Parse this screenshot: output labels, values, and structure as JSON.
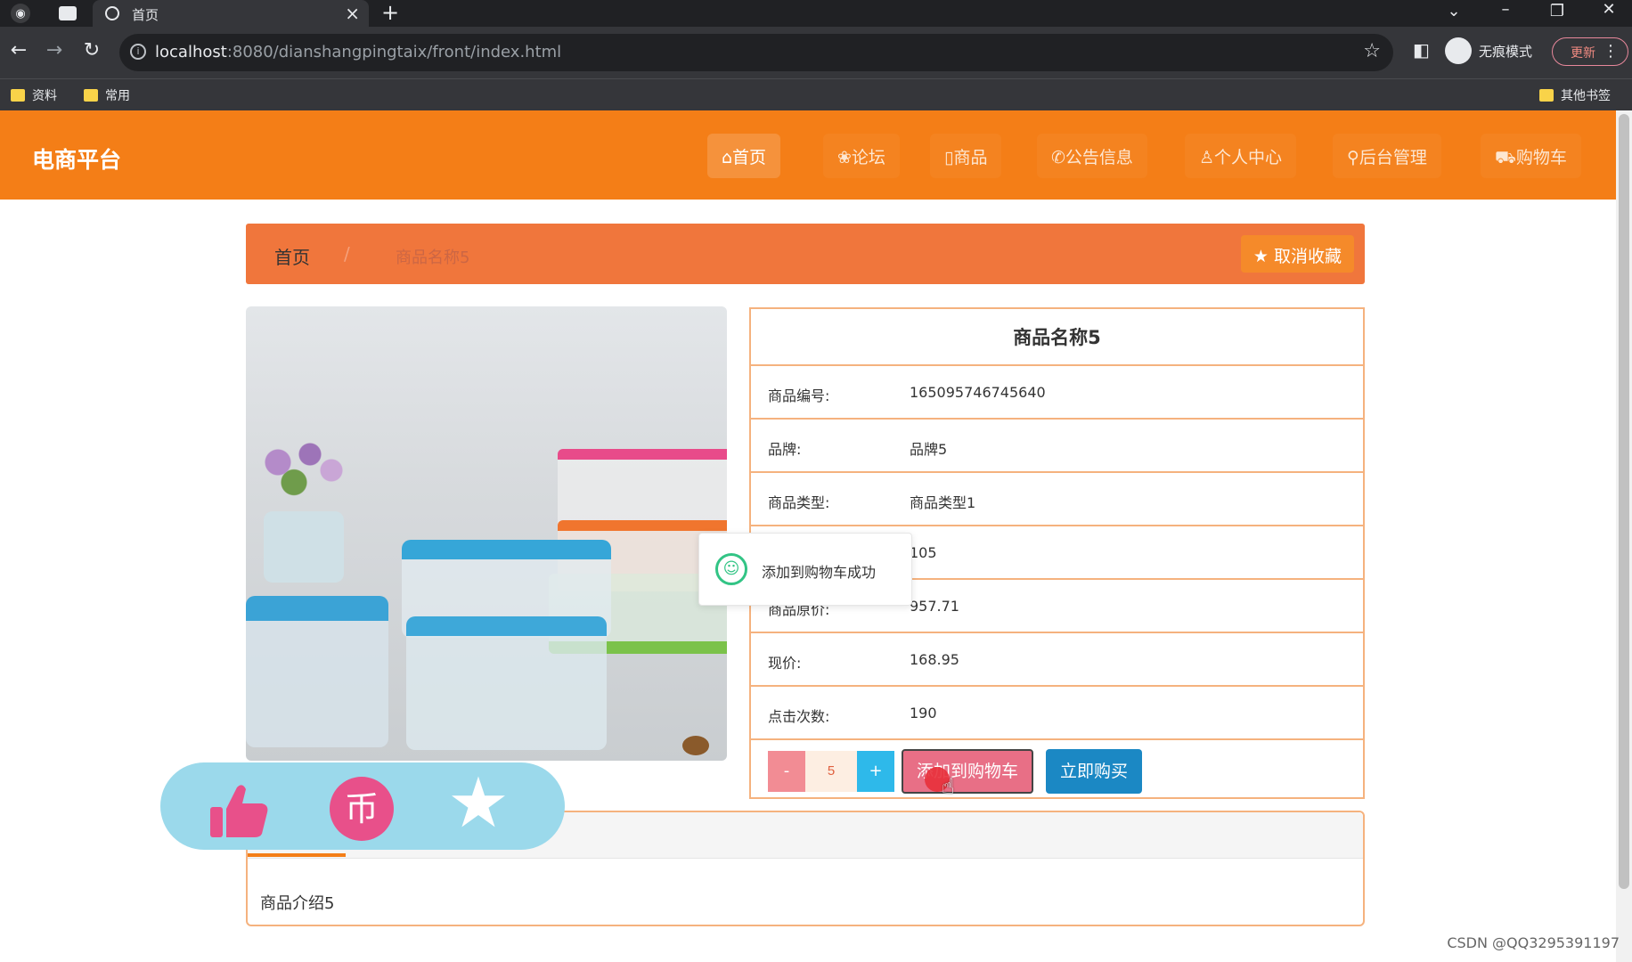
{
  "browser": {
    "tab_title": "首页",
    "url_host": "localhost",
    "url_rest": ":8080/dianshangpingtaix/front/index.html",
    "incognito_label": "无痕模式",
    "update_label": "更新",
    "bookmarks": [
      "资料",
      "常用"
    ],
    "other_bookmarks": "其他书签"
  },
  "header": {
    "brand": "电商平台",
    "nav": [
      {
        "icon": "home-icon",
        "label": "⌂首页"
      },
      {
        "icon": "forum-icon",
        "label": "❀论坛"
      },
      {
        "icon": "goods-icon",
        "label": "▯商品"
      },
      {
        "icon": "notice-icon",
        "label": "✆公告信息"
      },
      {
        "icon": "user-icon",
        "label": "♙个人中心"
      },
      {
        "icon": "admin-icon",
        "label": "⚲后台管理"
      },
      {
        "icon": "cart-icon",
        "label": "⛟购物车"
      }
    ]
  },
  "breadcrumb": {
    "home": "首页",
    "separator": "/",
    "current": "商品名称5",
    "favorite_button": "★ 取消收藏"
  },
  "product": {
    "title": "商品名称5",
    "rows": [
      {
        "label": "商品编号:",
        "value": "165095746745640"
      },
      {
        "label": "品牌:",
        "value": "品牌5"
      },
      {
        "label": "商品类型:",
        "value": "商品类型1"
      },
      {
        "label": "",
        "value": "105"
      },
      {
        "label": "商品原价:",
        "value": "957.71"
      },
      {
        "label": "现价:",
        "value": "168.95"
      },
      {
        "label": "点击次数:",
        "value": "190"
      }
    ],
    "quantity": "5",
    "minus_label": "-",
    "plus_label": "+",
    "add_to_cart": "添加到购物车",
    "buy_now": "立即购买"
  },
  "toast": {
    "message": "添加到购物车成功"
  },
  "intro": {
    "text": "商品介绍5"
  },
  "watermark": "CSDN @QQ3295391197",
  "colors": {
    "header": "#f47e17",
    "breadcrumb": "#f0763c",
    "border": "#f5b27e",
    "cart_button": "#e86f86",
    "buy_button": "#1b88c4"
  }
}
